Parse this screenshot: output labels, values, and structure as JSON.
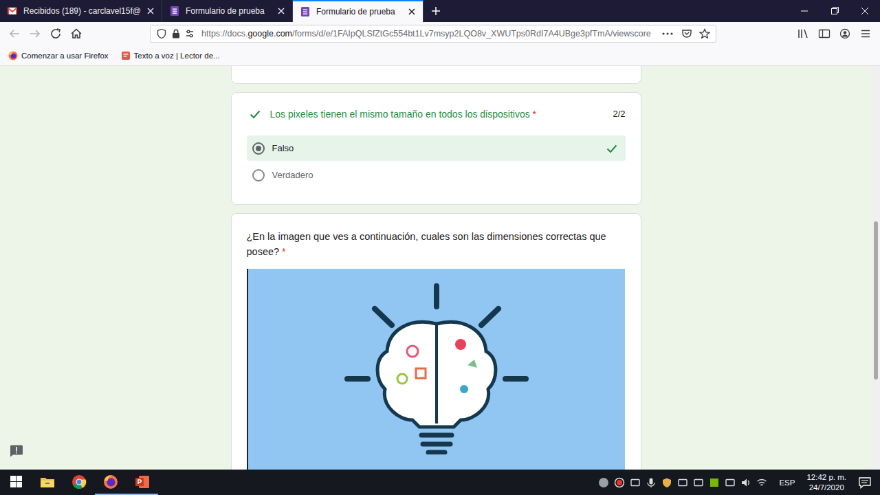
{
  "browser": {
    "tabs": [
      {
        "label": "Recibidos (189) - carclavel15f@",
        "kind": "mail",
        "selected": false
      },
      {
        "label": "Formulario de prueba",
        "kind": "form",
        "selected": false
      },
      {
        "label": "Formulario de prueba",
        "kind": "form",
        "selected": true
      }
    ],
    "url": {
      "prefix": "https://docs.",
      "domain": "google.com",
      "rest": "/forms/d/e/1FAIpQLSfZtGc554bt1Lv7msyp2LQO8v_XWUTps0RdI7A4UBge3pfTmA/viewscore"
    },
    "bookmarks": [
      {
        "label": "Comenzar a usar Firefox",
        "kind": "firefox"
      },
      {
        "label": "Texto a voz | Lector de...",
        "kind": "page"
      }
    ]
  },
  "form": {
    "questions": [
      {
        "kind": "graded",
        "title": "Los pixeles tienen el mismo tamaño en todos los dispositivos",
        "required_mark": "*",
        "score": "2/2",
        "correct": true,
        "options": [
          {
            "label": "Falso",
            "selected": true,
            "correct": true
          },
          {
            "label": "Verdadero",
            "selected": false,
            "correct": false
          }
        ]
      },
      {
        "kind": "image",
        "title": "¿En la imagen que ves a continuación, cuales son las dimensiones correctas que posee?",
        "required_mark": "*"
      }
    ]
  },
  "taskbar": {
    "apps": [
      {
        "kind": "explorer",
        "running": false
      },
      {
        "kind": "chrome",
        "running": false
      },
      {
        "kind": "firefox",
        "running": true
      },
      {
        "kind": "powerpoint",
        "running": true
      }
    ],
    "language": "ESP",
    "time": "12:42 p. m.",
    "date": "24/7/2020"
  }
}
